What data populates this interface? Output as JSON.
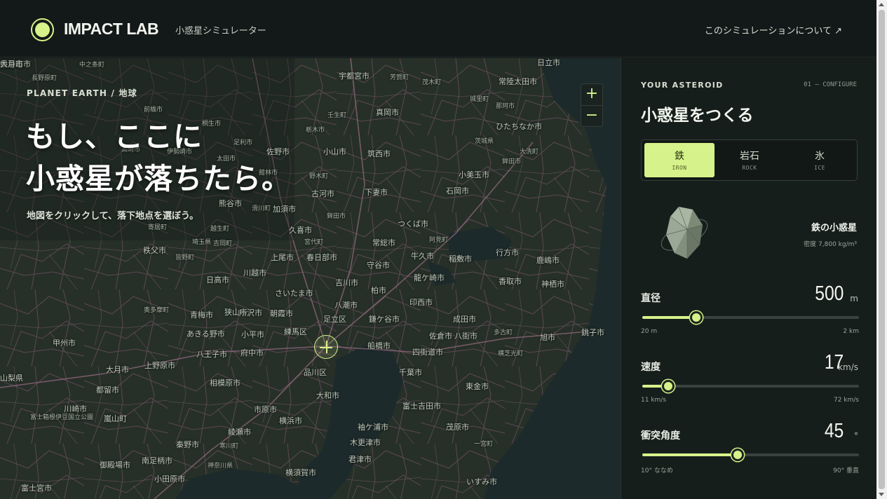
{
  "header": {
    "brand": "IMPACT LAB",
    "subtitle": "小惑星シミュレーター",
    "about_link": "このシミュレーションについて ↗"
  },
  "map": {
    "kicker": "PLANET EARTH / 地球",
    "headline_line1": "もし、ここに",
    "headline_line2": "小惑星が落ちたら。",
    "hint": "地図をクリックして、落下地点を選ぼう。",
    "zoom_in": "+",
    "zoom_out": "−",
    "place_labels": [
      "中之条町",
      "長野原町",
      "日立市",
      "宇都宮市",
      "芳賀町",
      "茂木町",
      "常陸太田市",
      "城里町",
      "那珂市",
      "前橋市",
      "壬生町",
      "真岡市",
      "ひたちなか市",
      "桐生市",
      "足利市",
      "栃木市",
      "茨城県",
      "大洗町",
      "高崎市",
      "伊勢崎市",
      "太田市",
      "佐野市",
      "小山市",
      "筑西市",
      "鉾田市",
      "館林市",
      "野木町",
      "小美玉市",
      "古河市",
      "下妻市",
      "石岡市",
      "熊谷市",
      "加須市",
      "つくば市",
      "鉾田市",
      "久喜市",
      "宮代町",
      "常総市",
      "阿見町",
      "行方市",
      "上尾市",
      "春日部市",
      "牛久市",
      "稲敷市",
      "鹿嶋市",
      "守谷市",
      "川越市",
      "吉川市",
      "龍ケ崎市",
      "香取市",
      "神栖市",
      "日高市",
      "さいたま市",
      "柏市",
      "狭山市",
      "所沢市",
      "朝霞市",
      "八潮市",
      "印西市",
      "成田市",
      "足立区",
      "鎌ケ谷市",
      "青梅市",
      "練馬区",
      "あきる野市",
      "小平市",
      "佐倉市",
      "八街市",
      "多古町",
      "旭市",
      "銚子市",
      "八王子市",
      "府中市",
      "船橋市",
      "四街道市",
      "横芝光町",
      "相模原市",
      "千葉市",
      "品川区",
      "東金市",
      "大月市",
      "上野原市",
      "都留市",
      "川崎市",
      "大和市",
      "市原市",
      "富士吉田市",
      "綾瀬市",
      "横浜市",
      "袖ケ浦市",
      "茂原市",
      "木更津市",
      "一宮町",
      "秦野市",
      "寒川町",
      "君津市",
      "御殿場市",
      "南足柄市",
      "神奈川県",
      "小田原市",
      "横須賀市",
      "いすみ市",
      "富士宮市",
      "秩父市",
      "埼玉県",
      "奥多摩町",
      "甲州市",
      "山梨県",
      "富士箱根伊豆国立公園",
      "越生町",
      "滑川町",
      "寄居町",
      "吉岡町",
      "皆野町",
      "嵐山町",
      "鶴ヶ島市",
      "長瀞町",
      "大月市"
    ]
  },
  "panel": {
    "kicker": "YOUR ASTEROID",
    "step": "01 — CONFIGURE",
    "title": "小惑星をつくる",
    "materials": [
      {
        "label": "鉄",
        "sub": "IRON",
        "active": true
      },
      {
        "label": "岩石",
        "sub": "ROCK",
        "active": false
      },
      {
        "label": "氷",
        "sub": "ICE",
        "active": false
      }
    ],
    "material_name": "鉄の小惑星",
    "material_density": "密度 7,800 kg/m³",
    "params": [
      {
        "label": "直径",
        "value": "500",
        "unit": "m",
        "min": "20 m",
        "max": "2 km",
        "fraction": 0.25
      },
      {
        "label": "速度",
        "value": "17",
        "unit": "km/s",
        "min": "11 km/s",
        "max": "72 km/s",
        "fraction": 0.12
      },
      {
        "label": "衝突角度",
        "value": "45",
        "unit": "°",
        "min": "10° ななめ",
        "max": "90° 垂直",
        "fraction": 0.44
      }
    ]
  },
  "colors": {
    "accent": "#d6f28a",
    "background": "#121817",
    "map_land": "#242e27",
    "map_water": "#1d2a2b",
    "roads": "#7a5a6e"
  }
}
